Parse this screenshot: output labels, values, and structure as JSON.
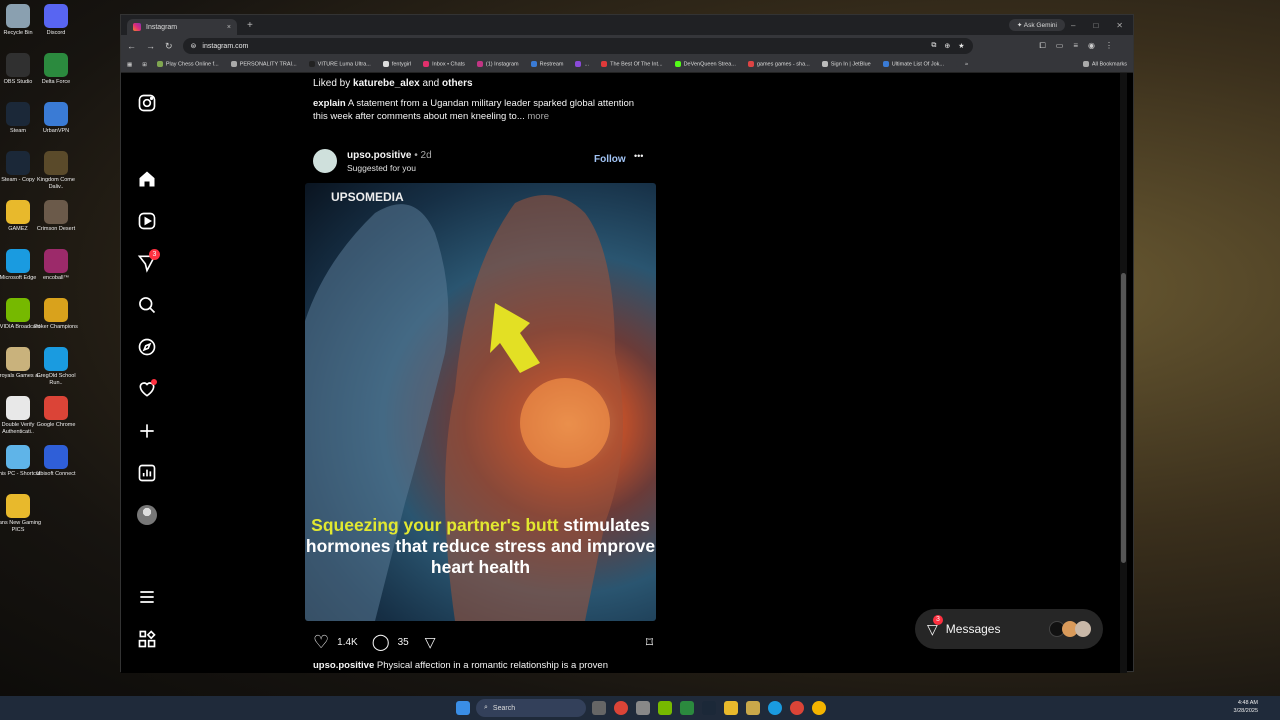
{
  "desktop": {
    "icons": [
      {
        "label": "Recycle Bin",
        "color": "#8aa0b0"
      },
      {
        "label": "Discord",
        "color": "#5865f2"
      },
      {
        "label": "OBS Studio",
        "color": "#303030"
      },
      {
        "label": "Delta Force",
        "color": "#2b8a3e"
      },
      {
        "label": "Steam",
        "color": "#1b2838"
      },
      {
        "label": "UrbanVPN",
        "color": "#3a7bd5"
      },
      {
        "label": "Steam - Copy",
        "color": "#1b2838"
      },
      {
        "label": "Kingdom Come Daliv..",
        "color": "#5a4a2a"
      },
      {
        "label": "GAMEZ",
        "color": "#e8b92c"
      },
      {
        "label": "Crimson Desert",
        "color": "#6b5a4a"
      },
      {
        "label": "Microsoft Edge",
        "color": "#1a9be0"
      },
      {
        "label": "encoball™",
        "color": "#9c2a6a"
      },
      {
        "label": "NVIDIA Broadcast",
        "color": "#76b900"
      },
      {
        "label": "Poker Champions",
        "color": "#d9a21c"
      },
      {
        "label": "Wroyals Games a..",
        "color": "#c9b27c"
      },
      {
        "label": "GregOld School Run..",
        "color": "#1a9be0"
      },
      {
        "label": "Double Verify Authenticati..",
        "color": "#e8e8e8"
      },
      {
        "label": "Google Chrome",
        "color": "#db4437"
      },
      {
        "label": "This PC - Shortcut",
        "color": "#5fb4e8"
      },
      {
        "label": "Ubisoft Connect",
        "color": "#2f5fd8"
      },
      {
        "label": "Dans New Gaming PICS",
        "color": "#e8b92c"
      }
    ]
  },
  "browser": {
    "tab_title": "Instagram",
    "tab_close": "×",
    "new_tab": "+",
    "ask_gemini": "Ask Gemini",
    "url": "instagram.com",
    "bookmarks": [
      {
        "label": "Play Chess Online f...",
        "color": "#7fa650"
      },
      {
        "label": "PERSONALITY TRAI...",
        "color": "#aaaaaa"
      },
      {
        "label": "VITURE Luma Ultra...",
        "color": "#222222"
      },
      {
        "label": "fentygirl",
        "color": "#dddddd"
      },
      {
        "label": "Inbox • Chats",
        "color": "#e1306c"
      },
      {
        "label": "(1) Instagram",
        "color": "#c13584"
      },
      {
        "label": "Restream",
        "color": "#3a7bd5"
      },
      {
        "label": "...",
        "color": "#8a4ad8"
      },
      {
        "label": "The Best Of The Int...",
        "color": "#e03a3a"
      },
      {
        "label": "DeVenQueen Strea...",
        "color": "#53fc18"
      },
      {
        "label": "games games - sha...",
        "color": "#dd4444"
      },
      {
        "label": "Sign In | JetBlue",
        "color": "#bbbbbb"
      },
      {
        "label": "Ultimate List Of Jok...",
        "color": "#3a7bd5"
      },
      {
        "label": "»",
        "color": "#35363a"
      },
      {
        "label": "All Bookmarks",
        "color": "#aaaaaa"
      }
    ]
  },
  "instagram": {
    "notification_count": "3",
    "prev_post": {
      "liked_by_prefix": "Liked by",
      "liked_by_user": "katurebe_alex",
      "liked_by_and": "and",
      "liked_by_others": "others",
      "caption_user": "explain",
      "caption_text": "A statement from a Ugandan military leader sparked global attention this week after comments about men kneeling to...",
      "more": "more"
    },
    "post": {
      "username": "upso.positive",
      "time": "• 2d",
      "suggested": "Suggested for you",
      "follow": "Follow",
      "options": "•••",
      "image_brand": "UPSOMEDIA",
      "image_text_highlight": "Squeezing your partner's butt",
      "image_text_rest": "stimulates hormones that reduce stress and improve heart health",
      "likes": "1.4K",
      "comments": "35",
      "caption_user": "upso.positive",
      "caption_text": "Physical affection in a romantic relationship is a proven"
    },
    "messages": {
      "label": "Messages",
      "badge": "3"
    }
  },
  "taskbar": {
    "search_placeholder": "Search",
    "time": "4:48 AM",
    "date": "3/28/2025"
  }
}
